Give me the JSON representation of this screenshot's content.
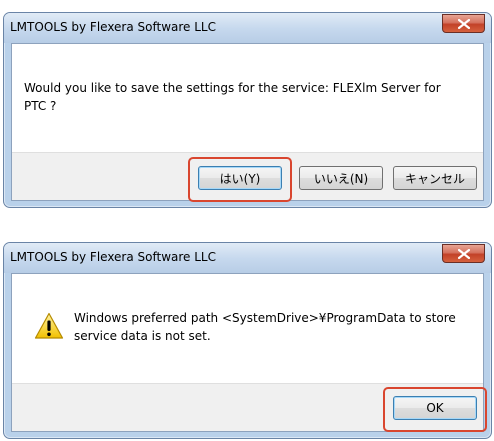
{
  "dialog1": {
    "title": "LMTOOLS by Flexera Software LLC",
    "message": "Would you like to save the settings for the service:    FLEXlm Server for PTC    ?",
    "buttons": {
      "yes": "はい(Y)",
      "no": "いいえ(N)",
      "cancel": "キャンセル"
    }
  },
  "dialog2": {
    "title": "LMTOOLS by Flexera Software LLC",
    "message": "Windows preferred path <SystemDrive>¥ProgramData to store service data is not set.",
    "buttons": {
      "ok": "OK"
    },
    "icon": "warning-icon"
  },
  "colors": {
    "highlight": "#d9462f",
    "close_button": "#c24128",
    "frame": "#b9d1ea"
  }
}
